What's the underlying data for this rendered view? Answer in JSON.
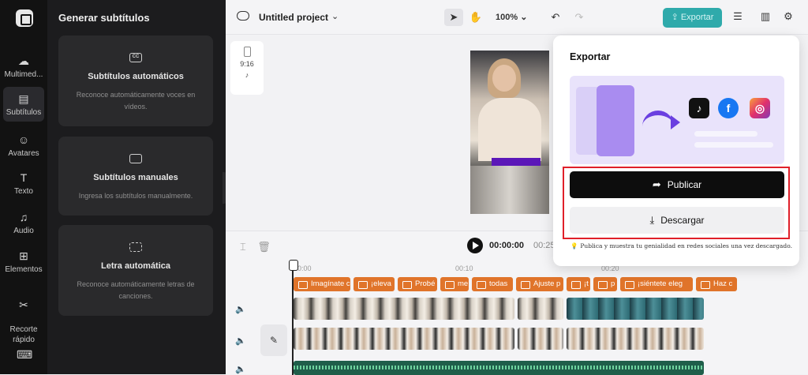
{
  "rail": {
    "items": [
      {
        "label": "Multimed...",
        "icon": "cloud-upload-icon"
      },
      {
        "label": "Subtítulos",
        "icon": "subtitles-icon",
        "active": true
      },
      {
        "label": "Avatares",
        "icon": "avatar-icon"
      },
      {
        "label": "Texto",
        "icon": "text-icon"
      },
      {
        "label": "Audio",
        "icon": "music-icon"
      },
      {
        "label": "Elementos",
        "icon": "elements-icon"
      },
      {
        "label": "Recorte\nrápido",
        "icon": "quick-cut-icon"
      },
      {
        "label": "",
        "icon": "keyboard-icon"
      }
    ]
  },
  "panel": {
    "title": "Generar subtítulos",
    "cards": [
      {
        "title": "Subtítulos automáticos",
        "desc": "Reconoce automáticamente voces en vídeos.",
        "icon": "cc-icon"
      },
      {
        "title": "Subtítulos manuales",
        "desc": "Ingresa los subtítulos manualmente.",
        "icon": "keyboard-icon"
      },
      {
        "title": "Letra automática",
        "desc": "Reconoce automáticamente letras de canciones.",
        "icon": "scan-lyrics-icon"
      }
    ]
  },
  "topbar": {
    "project_name": "Untitled project",
    "zoom": "100%",
    "export_label": "Exportar"
  },
  "canvas": {
    "ratio": "9:16"
  },
  "timeline": {
    "current_time": "00:00:00",
    "end_time": "00:25",
    "ruler": [
      "00:00",
      "00:10",
      "00:20"
    ],
    "subtitle_clips": [
      "Imagínate c",
      "¡eleva",
      "Probé",
      "me",
      "todas",
      "Ajuste p",
      "¡t",
      "p",
      "¡siéntete eleg",
      "Haz c"
    ]
  },
  "export_modal": {
    "title": "Exportar",
    "publish_label": "Publicar",
    "download_label": "Descargar",
    "tip": "Publica y muestra tu genialidad en redes sociales una vez descargado.",
    "socials": [
      "tiktok-icon",
      "facebook-icon",
      "instagram-icon"
    ],
    "colors": {
      "accent": "#1aa3a3",
      "highlight": "#e0202a",
      "banner": "#e9e3fb"
    }
  }
}
